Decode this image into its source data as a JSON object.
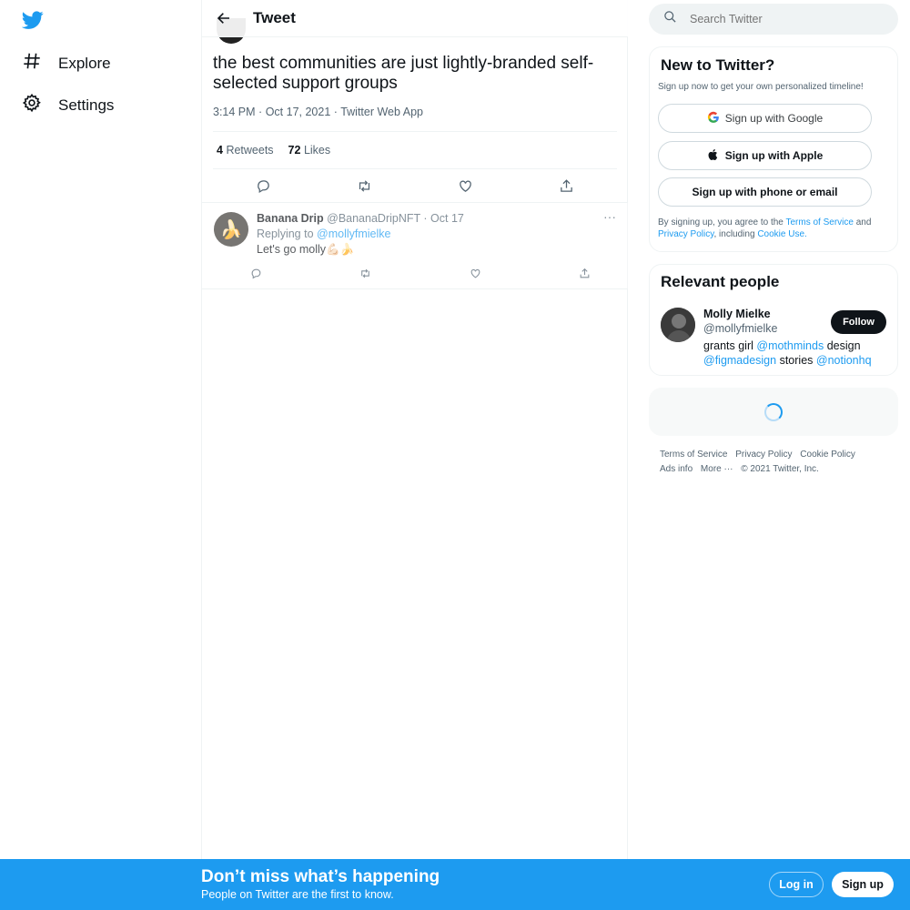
{
  "nav": {
    "logo": "twitter-bird-icon",
    "items": [
      {
        "label": "Explore",
        "icon": "hashtag-icon"
      },
      {
        "label": "Settings",
        "icon": "gear-icon"
      }
    ]
  },
  "header": {
    "title": "Tweet"
  },
  "tweet": {
    "text": "the best communities are just lightly-branded self-selected support groups",
    "time": "3:14 PM",
    "date": "Oct 17, 2021",
    "source": "Twitter Web App",
    "sep": "·",
    "retweets_count": "4",
    "retweets_label": "Retweets",
    "likes_count": "72",
    "likes_label": "Likes"
  },
  "reply": {
    "name": "Banana Drip",
    "handle": "@BananaDripNFT",
    "sep": "·",
    "date": "Oct 17",
    "replying_prefix": "Replying to",
    "replying_to": "@mollyfmielke",
    "text": "Let's go molly💪🏻🍌",
    "avatar_emoji": "🍌"
  },
  "search": {
    "placeholder": "Search Twitter"
  },
  "new_to_twitter": {
    "title": "New to Twitter?",
    "subtitle": "Sign up now to get your own personalized timeline!",
    "google_label": "Sign up with Google",
    "apple_label": "Sign up with Apple",
    "phone_label": "Sign up with phone or email",
    "terms_prefix": "By signing up, you agree to the",
    "terms_link": "Terms of Service",
    "terms_and": "and",
    "privacy_link": "Privacy Policy",
    "terms_including": ", including",
    "cookie_link": "Cookie Use",
    "terms_end": "."
  },
  "relevant_people": {
    "title": "Relevant people",
    "name": "Molly Mielke",
    "handle": "@mollyfmielke",
    "follow_label": "Follow",
    "bio_1": "grants girl",
    "bio_link_1": "@mothminds",
    "bio_2": "design",
    "bio_link_2": "@figmadesign",
    "bio_3": "stories",
    "bio_link_3": "@notionhq"
  },
  "footer": {
    "terms": "Terms of Service",
    "privacy": "Privacy Policy",
    "cookie": "Cookie Policy",
    "ads": "Ads info",
    "more": "More ···",
    "copyright": "© 2021 Twitter, Inc."
  },
  "bottom_bar": {
    "title": "Don’t miss what’s happening",
    "subtitle": "People on Twitter are the first to know.",
    "login": "Log in",
    "signup": "Sign up"
  },
  "colors": {
    "brand": "#1d9bf0",
    "text": "#0f1419",
    "muted": "#536471"
  }
}
